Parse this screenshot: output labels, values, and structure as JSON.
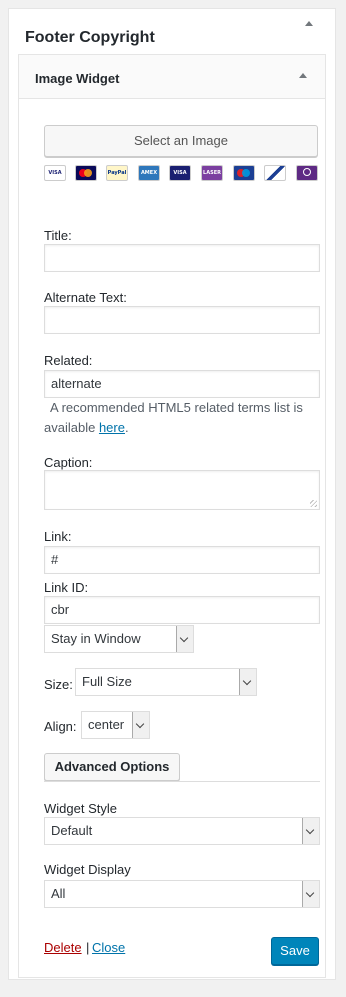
{
  "sidebar_area": {
    "title": "Footer Copyright"
  },
  "widget": {
    "title": "Image Widget",
    "select_image_label": "Select an Image",
    "payment_icons": [
      {
        "name": "visa",
        "text": "VISA"
      },
      {
        "name": "mastercard",
        "text": "MC"
      },
      {
        "name": "paypal",
        "text": "PayPal"
      },
      {
        "name": "amex",
        "text": "AMEX"
      },
      {
        "name": "visa-electron",
        "text": "VISA Electron"
      },
      {
        "name": "laser",
        "text": "LASER"
      },
      {
        "name": "maestro",
        "text": "Maestro"
      },
      {
        "name": "solo",
        "text": "SOLO"
      },
      {
        "name": "dankort",
        "text": "DELTA"
      }
    ],
    "fields": {
      "title_label": "Title:",
      "title_value": "",
      "alt_label": "Alternate Text:",
      "alt_value": "",
      "related_label": "Related:",
      "related_value": "alternate",
      "related_help_prefix": "A recommended HTML5 related terms list is available",
      "related_help_link": "here",
      "related_help_suffix": ".",
      "caption_label": "Caption:",
      "link_label": "Link:",
      "link_value": "#",
      "link_id_label": "Link ID:",
      "link_id_value": "cbr",
      "window_select_value": "Stay in Window",
      "size_label": "Size:",
      "size_value": "Full Size",
      "align_label": "Align:",
      "align_value": "center"
    },
    "advanced_options_label": "Advanced Options",
    "widget_style_label": "Widget Style",
    "widget_style_value": "Default",
    "widget_display_label": "Widget Display",
    "widget_display_value": "All",
    "delete_label": "Delete",
    "separator": "|",
    "close_label": "Close",
    "save_label": "Save"
  },
  "colors": {
    "save_button": "#0085ba",
    "link": "#0073aa",
    "delete_link": "#aa0000"
  }
}
